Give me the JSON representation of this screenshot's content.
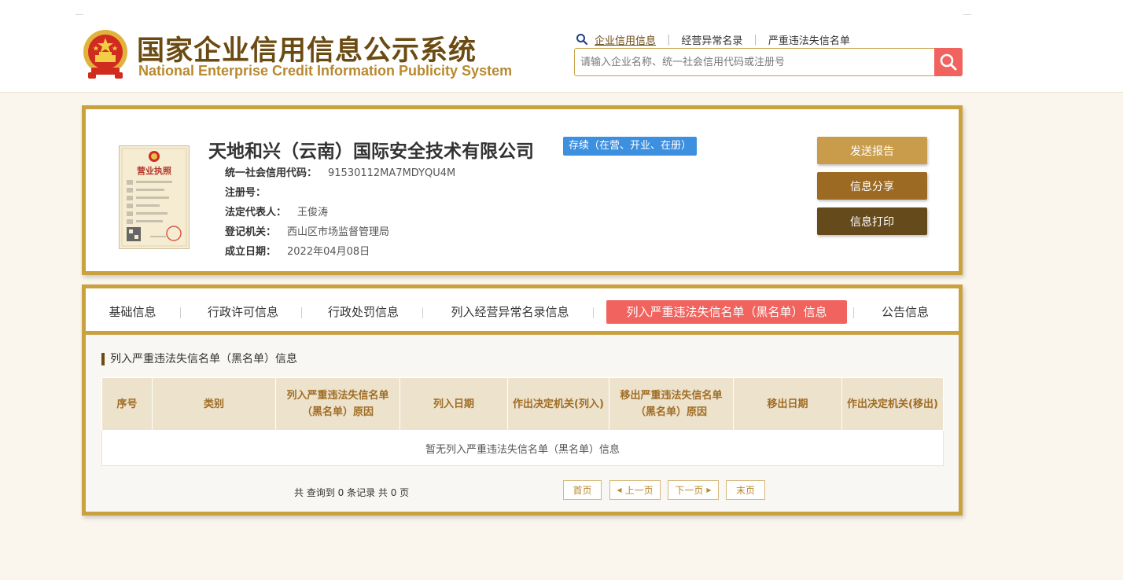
{
  "header": {
    "title_cn": "国家企业信用信息公示系统",
    "title_en": "National Enterprise Credit Information Publicity System",
    "links": [
      "企业信用信息",
      "经营异常名录",
      "严重违法失信名单"
    ],
    "search_placeholder": "请输入企业名称、统一社会信用代码或注册号"
  },
  "company": {
    "name": "天地和兴（云南）国际安全技术有限公司",
    "status": "存续（在营、开业、在册）",
    "license_title": "营业执照",
    "fields": [
      {
        "label": "统一社会信用代码：",
        "value": "91530112MA7MDYQU4M"
      },
      {
        "label": "注册号：",
        "value": ""
      },
      {
        "label": "法定代表人：",
        "value": "王俊涛"
      },
      {
        "label": "登记机关：",
        "value": "西山区市场监督管理局"
      },
      {
        "label": "成立日期：",
        "value": "2022年04月08日"
      }
    ]
  },
  "actions": {
    "send": "发送报告",
    "share": "信息分享",
    "print": "信息打印"
  },
  "tabs": [
    "基础信息",
    "行政许可信息",
    "行政处罚信息",
    "列入经营异常名录信息",
    "列入严重违法失信名单（黑名单）信息",
    "公告信息"
  ],
  "section": {
    "title": "列入严重违法失信名单（黑名单）信息",
    "columns": [
      "序号",
      "类别",
      "列入严重违法失信名单（黑名单）原因",
      "列入日期",
      "作出决定机关(列入)",
      "移出严重违法失信名单（黑名单）原因",
      "移出日期",
      "作出决定机关(移出)"
    ],
    "empty_text": "暂无列入严重违法失信名单（黑名单）信息",
    "total_text": "共 查询到 0 条记录 共 0 页"
  },
  "pagination": {
    "first": "首页",
    "prev": "上一页",
    "next": "下一页",
    "last": "末页"
  },
  "colors": {
    "gold": "#c9a13f",
    "brown": "#6b4b12",
    "accent_red": "#f1635e",
    "status_blue": "#3d8fe0"
  }
}
